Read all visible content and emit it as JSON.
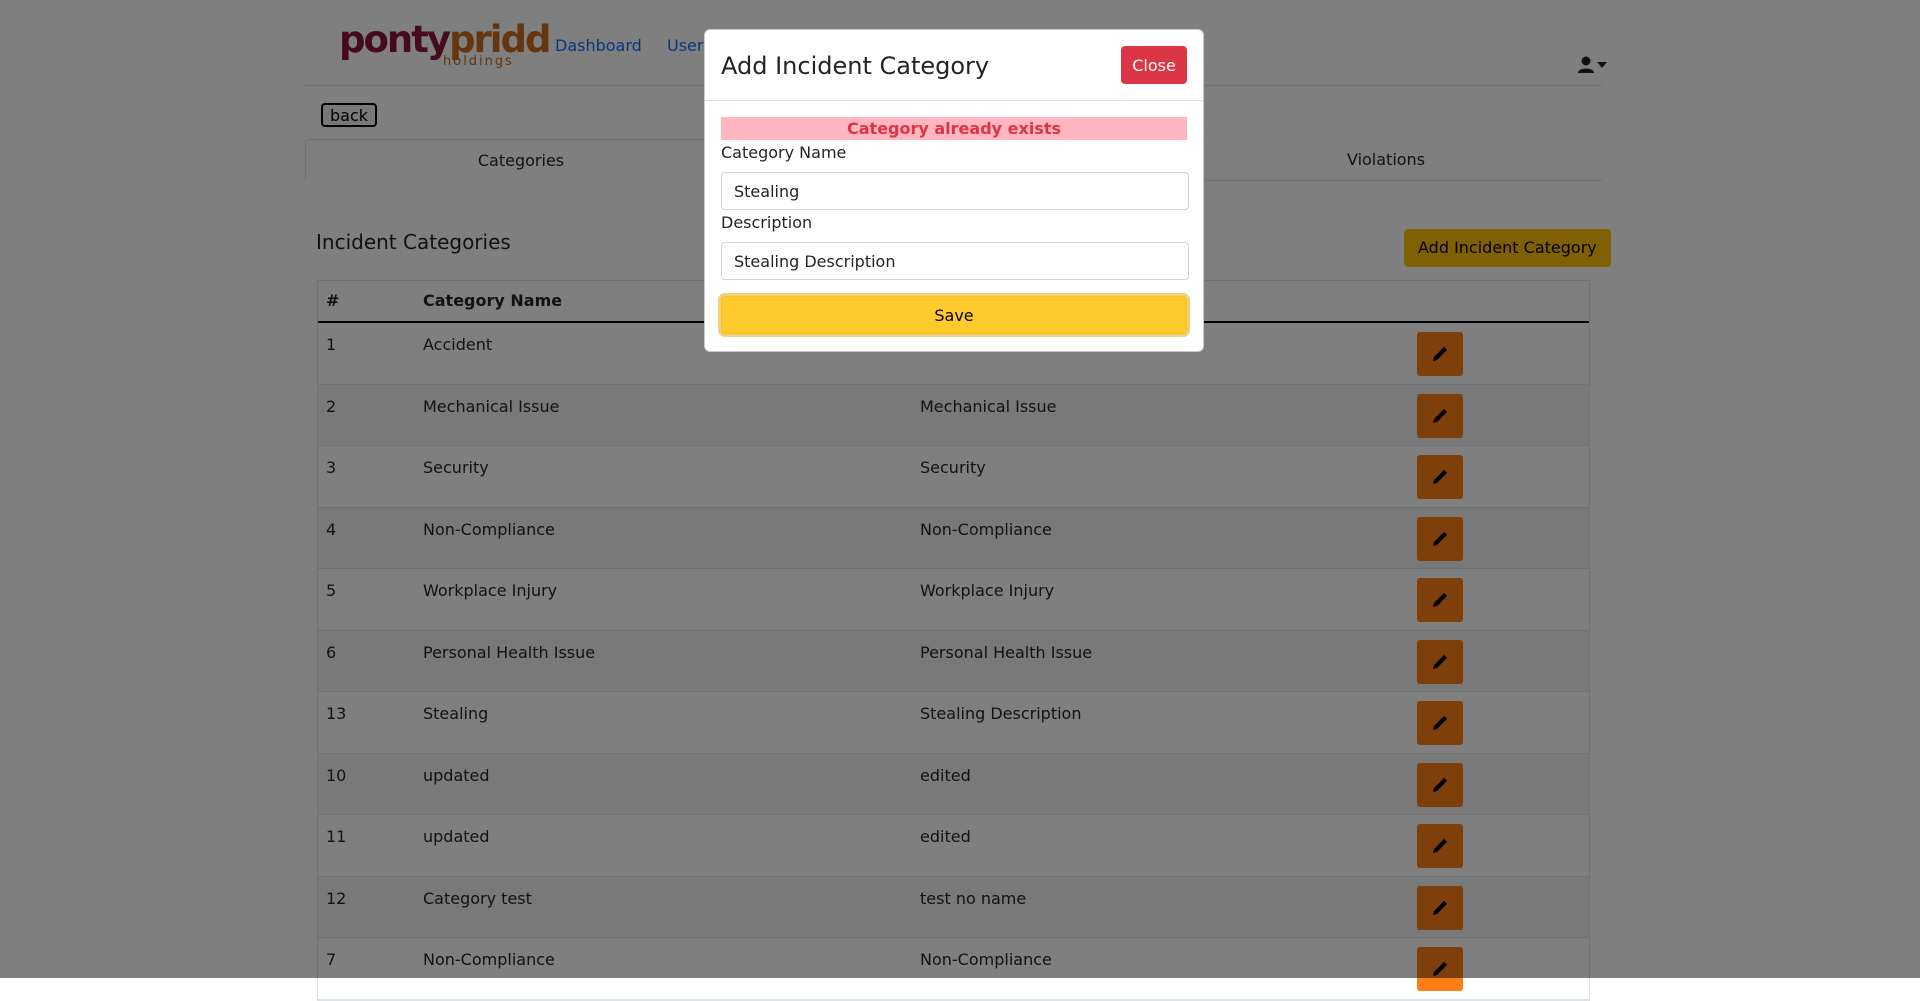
{
  "brand": {
    "logo_word_a": "ponty",
    "logo_word_b": "pridd",
    "logo_sub": "holdings"
  },
  "nav": {
    "links": [
      "Dashboard",
      "Users"
    ]
  },
  "back_label": "back",
  "tabs": [
    "Categories",
    "Violations"
  ],
  "section_title": "Incident Categories",
  "add_category_label": "Add Incident Category",
  "table": {
    "headers": [
      "#",
      "Category Name"
    ],
    "rows": [
      {
        "id": "1",
        "name": "Accident",
        "description": ""
      },
      {
        "id": "2",
        "name": "Mechanical Issue",
        "description": "Mechanical Issue"
      },
      {
        "id": "3",
        "name": "Security",
        "description": "Security"
      },
      {
        "id": "4",
        "name": "Non-Compliance",
        "description": "Non-Compliance"
      },
      {
        "id": "5",
        "name": "Workplace Injury",
        "description": "Workplace Injury"
      },
      {
        "id": "6",
        "name": "Personal Health Issue",
        "description": "Personal Health Issue"
      },
      {
        "id": "13",
        "name": "Stealing",
        "description": "Stealing Description"
      },
      {
        "id": "10",
        "name": "updated",
        "description": "edited"
      },
      {
        "id": "11",
        "name": "updated",
        "description": "edited"
      },
      {
        "id": "12",
        "name": "Category test",
        "description": "test no name"
      },
      {
        "id": "7",
        "name": "Non-Compliance",
        "description": "Non-Compliance"
      }
    ]
  },
  "modal": {
    "title": "Add Incident Category",
    "close_label": "Close",
    "alert_text": "Category already exists",
    "name_label": "Category Name",
    "name_value": "Stealing",
    "description_label": "Description",
    "description_value": "Stealing Description",
    "save_label": "Save"
  },
  "colors": {
    "primary_link": "#0d6efd",
    "warning": "#ffc107",
    "danger": "#dc3545",
    "edit_button": "#fd7e14",
    "alert_bg": "#ffb6c1"
  },
  "icons": [
    "user-icon",
    "caret-down-icon",
    "pencil-icon"
  ]
}
